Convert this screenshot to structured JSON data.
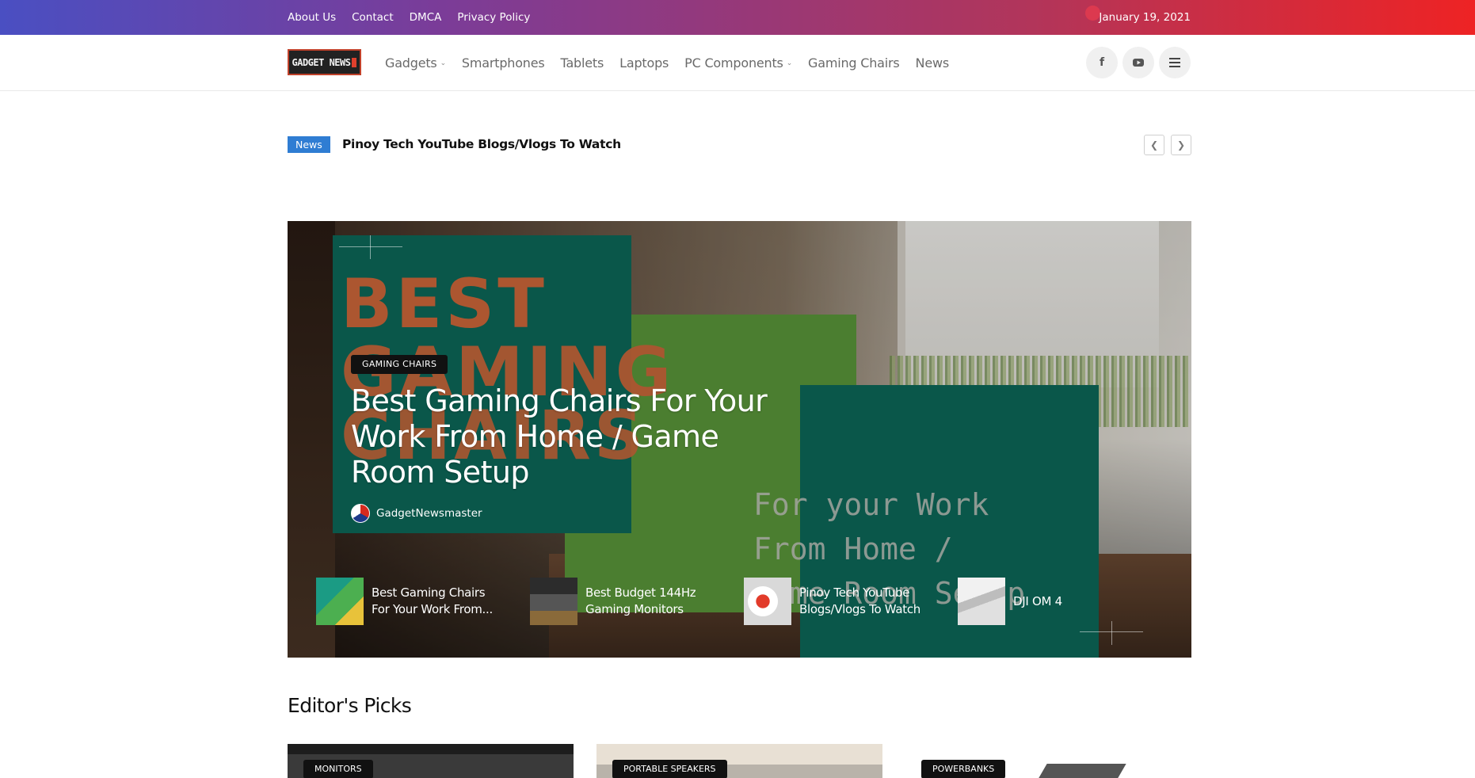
{
  "topbar": {
    "links": [
      "About Us",
      "Contact",
      "DMCA",
      "Privacy Policy"
    ],
    "date": "January 19, 2021"
  },
  "header": {
    "logo_text": "GADGET NEWS",
    "nav": [
      {
        "label": "Gadgets",
        "has_dropdown": true
      },
      {
        "label": "Smartphones",
        "has_dropdown": false
      },
      {
        "label": "Tablets",
        "has_dropdown": false
      },
      {
        "label": "Laptops",
        "has_dropdown": false
      },
      {
        "label": "PC Components",
        "has_dropdown": true
      },
      {
        "label": "Gaming Chairs",
        "has_dropdown": false
      },
      {
        "label": "News",
        "has_dropdown": false
      }
    ],
    "icons": [
      "facebook-icon",
      "youtube-icon",
      "menu-icon"
    ]
  },
  "ticker": {
    "badge": "News",
    "title": "Pinoy Tech YouTube Blogs/Vlogs To Watch"
  },
  "hero": {
    "image_text": {
      "line1": "BEST",
      "line2": "GAMING",
      "line3": "CHAIRS",
      "mono": "For your Work\nFrom Home /\nGame Room Setup"
    },
    "category": "GAMING CHAIRS",
    "title": "Best Gaming Chairs For Your Work From Home / Game Room Setup",
    "author": "GadgetNewsmaster",
    "thumbnails": [
      {
        "title": "Best Gaming Chairs For Your Work From...",
        "colors": [
          "#1b9b84",
          "#4caf50",
          "#e8c23a"
        ]
      },
      {
        "title": "Best Budget 144Hz Gaming Monitors",
        "colors": [
          "#2c2c2c",
          "#555",
          "#8a6a3a"
        ]
      },
      {
        "title": "Pinoy Tech YouTube Blogs/Vlogs To Watch",
        "colors": [
          "#d9d9d9",
          "#e23b2a",
          "#ffffff"
        ]
      },
      {
        "title": "DJI OM 4",
        "colors": [
          "#f1f1f1",
          "#bdbdbd",
          "#e0e0e0"
        ]
      }
    ]
  },
  "picks": {
    "heading": "Editor's Picks",
    "items": [
      {
        "category": "MONITORS"
      },
      {
        "category": "PORTABLE SPEAKERS"
      },
      {
        "category": "POWERBANKS"
      }
    ]
  },
  "colors": {
    "accent_blue": "#2f7dd3",
    "hero_teal": "#0d6b5b",
    "hero_orange": "#d2693b"
  }
}
